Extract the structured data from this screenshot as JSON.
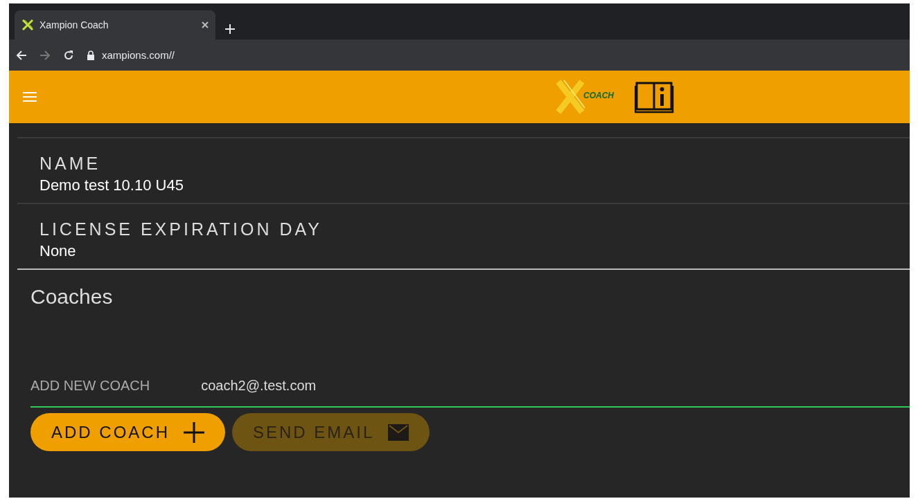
{
  "browser": {
    "tab_title": "Xampion Coach",
    "url": "xampions.com//"
  },
  "app_bar": {
    "logo_text": "COACH"
  },
  "fields": [
    {
      "label": "NAME",
      "value": "Demo test 10.10 U45"
    },
    {
      "label": "LICENSE EXPIRATION DAY",
      "value": "None"
    }
  ],
  "coaches": {
    "heading": "Coaches",
    "input_label": "ADD NEW COACH",
    "input_value": "coach2@.test.com",
    "buttons": [
      {
        "label": "ADD COACH",
        "kind": "add",
        "disabled": false
      },
      {
        "label": "SEND EMAIL",
        "kind": "email",
        "disabled": true
      }
    ]
  }
}
